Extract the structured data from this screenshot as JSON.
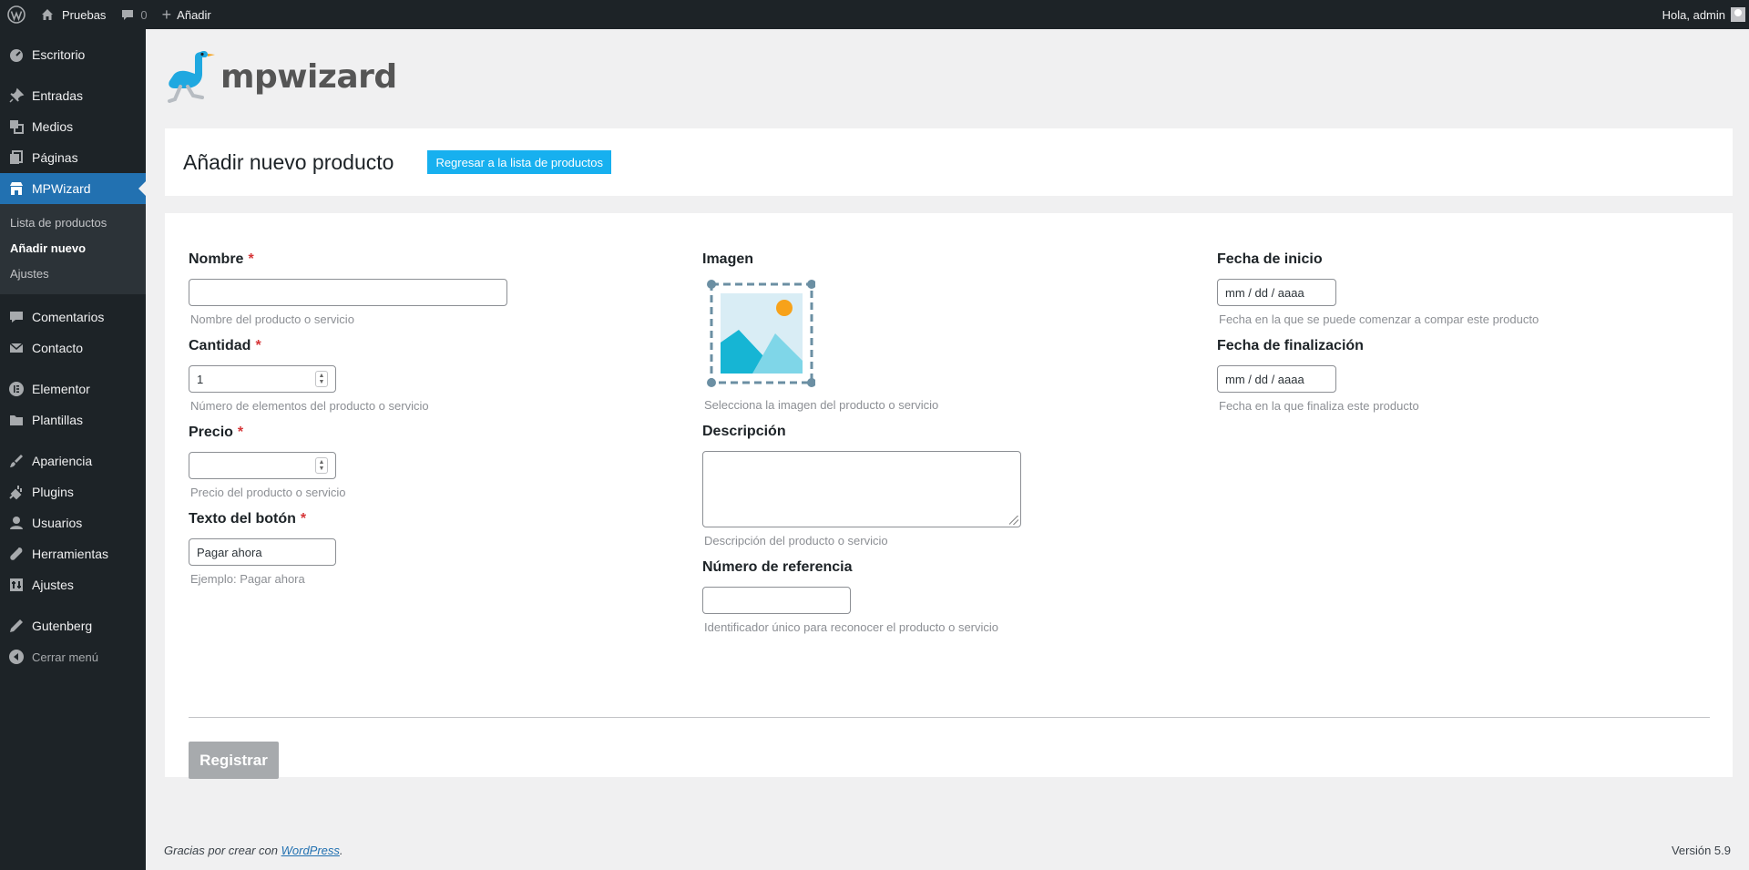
{
  "adminbar": {
    "site_name": "Pruebas",
    "comments_count": "0",
    "new_label": "Añadir",
    "greeting": "Hola, admin"
  },
  "sidebar": {
    "items": [
      {
        "label": "Escritorio",
        "icon": "dashboard-icon"
      },
      {
        "label": "Entradas",
        "icon": "pin-icon"
      },
      {
        "label": "Medios",
        "icon": "media-icon"
      },
      {
        "label": "Páginas",
        "icon": "pages-icon"
      },
      {
        "label": "MPWizard",
        "icon": "store-icon"
      },
      {
        "label": "Comentarios",
        "icon": "comment-icon"
      },
      {
        "label": "Contacto",
        "icon": "mail-icon"
      },
      {
        "label": "Elementor",
        "icon": "elementor-icon"
      },
      {
        "label": "Plantillas",
        "icon": "folder-icon"
      },
      {
        "label": "Apariencia",
        "icon": "brush-icon"
      },
      {
        "label": "Plugins",
        "icon": "plugin-icon"
      },
      {
        "label": "Usuarios",
        "icon": "user-icon"
      },
      {
        "label": "Herramientas",
        "icon": "wrench-icon"
      },
      {
        "label": "Ajustes",
        "icon": "settings-icon"
      },
      {
        "label": "Gutenberg",
        "icon": "pen-icon"
      }
    ],
    "submenu": [
      {
        "label": "Lista de productos"
      },
      {
        "label": "Añadir nuevo"
      },
      {
        "label": "Ajustes"
      }
    ],
    "collapse_label": "Cerrar menú",
    "active_color": "#2271b1"
  },
  "logo": {
    "text": "mpwizard"
  },
  "header": {
    "title": "Añadir nuevo producto",
    "back_button": "Regresar a la lista de productos"
  },
  "form": {
    "name": {
      "label": "Nombre",
      "required": "*",
      "value": "",
      "hint": "Nombre del producto o servicio"
    },
    "quantity": {
      "label": "Cantidad",
      "required": "*",
      "value": "1",
      "hint": "Número de elementos del producto o servicio"
    },
    "price": {
      "label": "Precio",
      "required": "*",
      "value": "",
      "hint": "Precio del producto o servicio"
    },
    "button_text": {
      "label": "Texto del botón",
      "required": "*",
      "value": "Pagar ahora",
      "hint": "Ejemplo: Pagar ahora"
    },
    "image": {
      "label": "Imagen",
      "hint": "Selecciona la imagen del producto o servicio"
    },
    "description": {
      "label": "Descripción",
      "value": "",
      "hint": "Descripción del producto o servicio"
    },
    "reference": {
      "label": "Número de referencia",
      "value": "",
      "hint": "Identificador único para reconocer el producto o servicio"
    },
    "start_date": {
      "label": "Fecha de inicio",
      "placeholder": "mm / dd / aaaa",
      "hint": "Fecha en la que se puede comenzar a compar este producto"
    },
    "end_date": {
      "label": "Fecha de finalización",
      "placeholder": "mm / dd / aaaa",
      "hint": "Fecha en la que finaliza este producto"
    },
    "submit": "Registrar"
  },
  "footer": {
    "thanks_prefix": "Gracias por crear con ",
    "thanks_link": "WordPress",
    "thanks_suffix": ".",
    "version": "Versión 5.9"
  }
}
